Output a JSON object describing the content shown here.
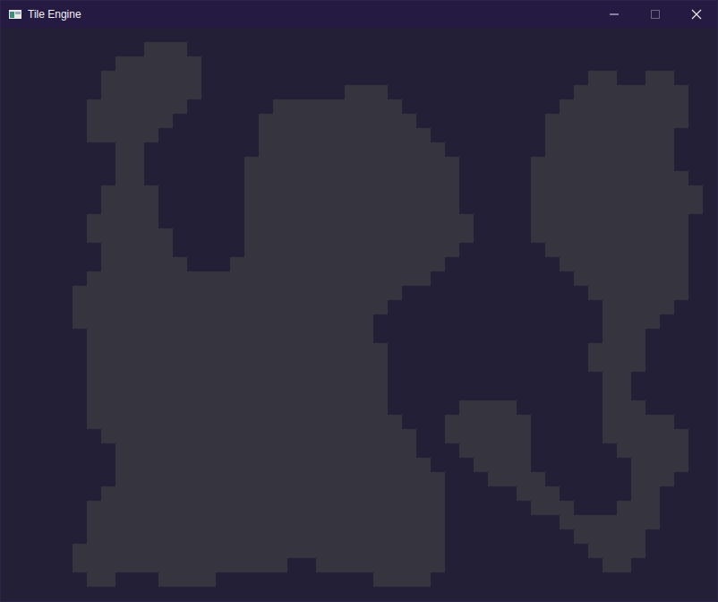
{
  "window": {
    "title": "Tile Engine"
  },
  "controls": [
    {
      "kind": "minimize",
      "disabled": false
    },
    {
      "kind": "maximize",
      "disabled": true
    },
    {
      "kind": "close",
      "disabled": false
    }
  ],
  "map": {
    "columns": 50,
    "rows": 40,
    "floor_spans": [
      [],
      [
        [
          10,
          12
        ]
      ],
      [
        [
          8,
          13
        ]
      ],
      [
        [
          7,
          13
        ],
        [
          41,
          42
        ],
        [
          45,
          46
        ]
      ],
      [
        [
          7,
          13
        ],
        [
          24,
          26
        ],
        [
          40,
          47
        ]
      ],
      [
        [
          6,
          12
        ],
        [
          19,
          27
        ],
        [
          39,
          47
        ]
      ],
      [
        [
          6,
          11
        ],
        [
          18,
          28
        ],
        [
          38,
          47
        ]
      ],
      [
        [
          6,
          10
        ],
        [
          18,
          29
        ],
        [
          38,
          46
        ]
      ],
      [
        [
          8,
          9
        ],
        [
          18,
          30
        ],
        [
          38,
          46
        ]
      ],
      [
        [
          8,
          9
        ],
        [
          17,
          31
        ],
        [
          37,
          46
        ]
      ],
      [
        [
          8,
          9
        ],
        [
          17,
          31
        ],
        [
          37,
          47
        ]
      ],
      [
        [
          7,
          10
        ],
        [
          17,
          31
        ],
        [
          37,
          48
        ]
      ],
      [
        [
          7,
          10
        ],
        [
          17,
          31
        ],
        [
          37,
          48
        ]
      ],
      [
        [
          6,
          10
        ],
        [
          17,
          32
        ],
        [
          37,
          47
        ]
      ],
      [
        [
          6,
          11
        ],
        [
          17,
          32
        ],
        [
          37,
          47
        ]
      ],
      [
        [
          7,
          11
        ],
        [
          17,
          31
        ],
        [
          38,
          47
        ]
      ],
      [
        [
          7,
          12
        ],
        [
          16,
          30
        ],
        [
          39,
          47
        ]
      ],
      [
        [
          6,
          29
        ],
        [
          40,
          47
        ]
      ],
      [
        [
          5,
          27
        ],
        [
          41,
          47
        ]
      ],
      [
        [
          5,
          26
        ],
        [
          42,
          46
        ]
      ],
      [
        [
          5,
          25
        ],
        [
          42,
          45
        ]
      ],
      [
        [
          6,
          25
        ],
        [
          42,
          44
        ]
      ],
      [
        [
          6,
          26
        ],
        [
          41,
          44
        ]
      ],
      [
        [
          6,
          26
        ],
        [
          41,
          44
        ]
      ],
      [
        [
          6,
          26
        ],
        [
          42,
          43
        ]
      ],
      [
        [
          6,
          26
        ],
        [
          42,
          43
        ]
      ],
      [
        [
          6,
          26
        ],
        [
          32,
          35
        ],
        [
          42,
          44
        ]
      ],
      [
        [
          6,
          27
        ],
        [
          31,
          36
        ],
        [
          42,
          46
        ]
      ],
      [
        [
          7,
          28
        ],
        [
          31,
          36
        ],
        [
          42,
          47
        ]
      ],
      [
        [
          8,
          28
        ],
        [
          32,
          36
        ],
        [
          43,
          47
        ]
      ],
      [
        [
          8,
          29
        ],
        [
          33,
          36
        ],
        [
          44,
          47
        ]
      ],
      [
        [
          8,
          30
        ],
        [
          34,
          37
        ],
        [
          44,
          46
        ]
      ],
      [
        [
          7,
          30
        ],
        [
          36,
          38
        ],
        [
          44,
          45
        ]
      ],
      [
        [
          6,
          30
        ],
        [
          37,
          39
        ],
        [
          43,
          45
        ]
      ],
      [
        [
          6,
          30
        ],
        [
          39,
          45
        ]
      ],
      [
        [
          6,
          30
        ],
        [
          40,
          44
        ]
      ],
      [
        [
          5,
          30
        ],
        [
          41,
          44
        ]
      ],
      [
        [
          5,
          19
        ],
        [
          22,
          30
        ],
        [
          42,
          43
        ]
      ],
      [
        [
          6,
          7
        ],
        [
          11,
          14
        ],
        [
          26,
          29
        ]
      ],
      []
    ]
  }
}
